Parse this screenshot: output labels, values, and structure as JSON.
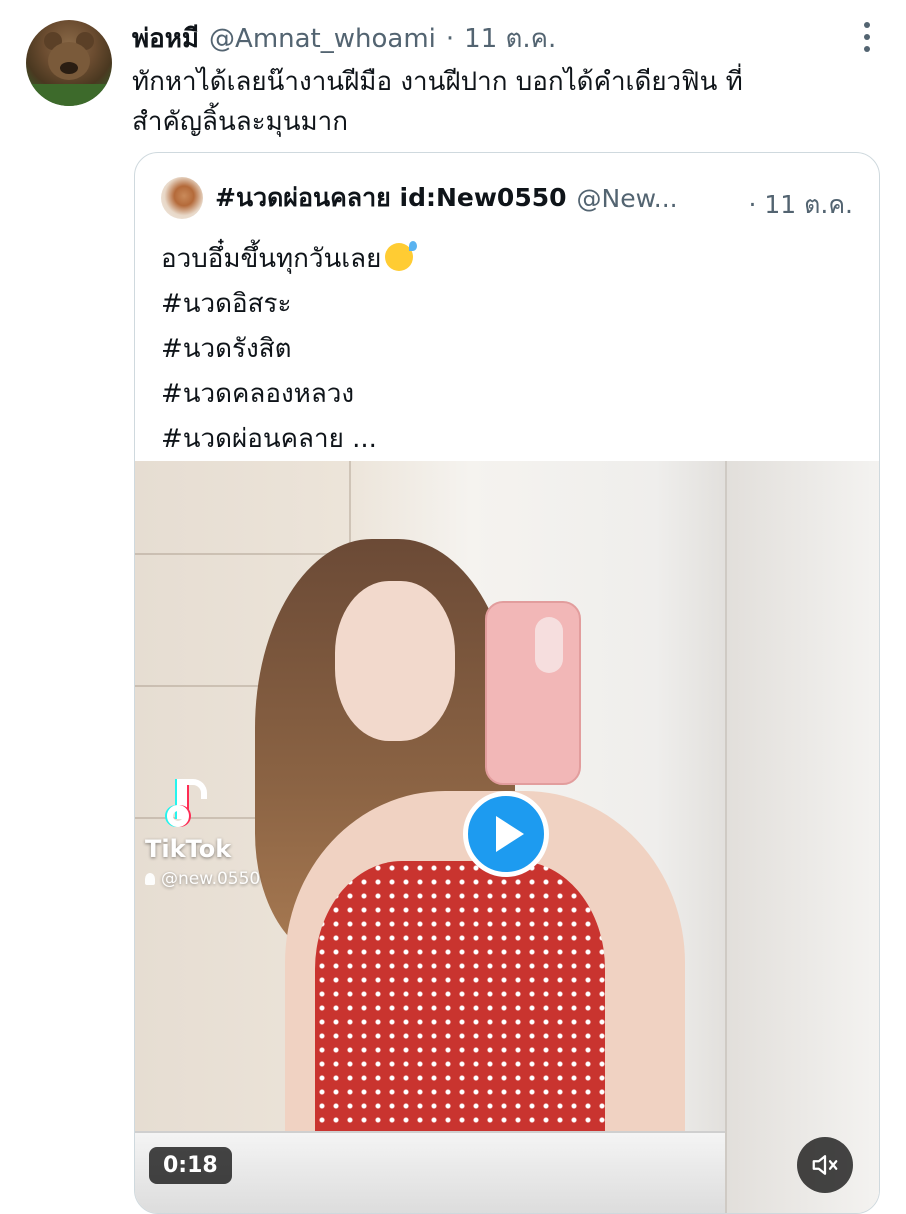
{
  "tweet": {
    "author_name": "พ่อหมี",
    "handle": "@Amnat_whoami",
    "separator": "·",
    "date": "11 ต.ค.",
    "text_line1": "ทักหาได้เลยน๊างานฝีมือ งานฝีปาก บอกได้คำเดียวฟิน ที่",
    "text_line2": "สำคัญลิ้นละมุนมาก",
    "more_icon": "more-vertical-icon"
  },
  "quote": {
    "author_name": "#นวดผ่อนคลาย id:New0550",
    "handle": "@New...",
    "date": "· 11 ต.ค.",
    "line1": "อวบอึ๋มขึ้นทุกวันเลย",
    "emoji": "sweat-smile-emoji",
    "hashtags": [
      "#นวดอิสระ",
      "#นวดรังสิต",
      "#นวดคลองหลวง",
      "#นวดผ่อนคลาย ..."
    ]
  },
  "video": {
    "watermark_brand": "TikTok",
    "watermark_user": "@new.0550",
    "duration": "0:18",
    "play_color": "#1d9bf0",
    "mute_icon": "volume-muted-icon"
  }
}
